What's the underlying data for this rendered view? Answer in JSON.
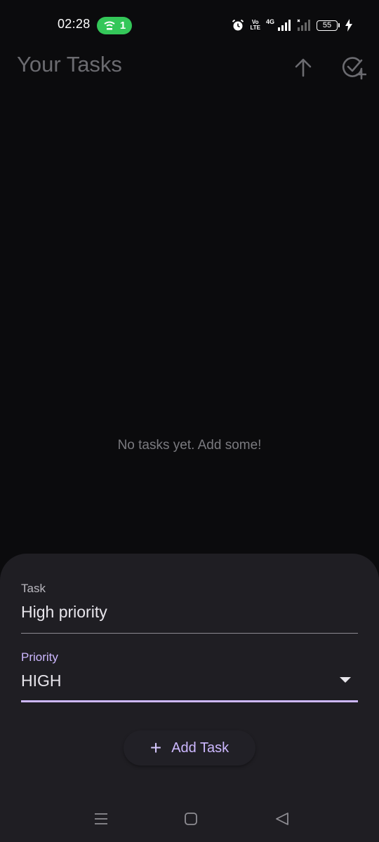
{
  "status_bar": {
    "time": "02:28",
    "hotspot_count": "1",
    "volte_top": "Vo",
    "volte_bottom": "LTE",
    "network_type": "4G",
    "battery_level": "55",
    "colors": {
      "hotspot": "#34c759"
    }
  },
  "app_bar": {
    "title": "Your Tasks",
    "sort_icon": "arrow-up-icon",
    "add_icon": "check-circle-plus-icon"
  },
  "empty_state": {
    "message": "No tasks yet. Add some!"
  },
  "sheet": {
    "task_label": "Task",
    "task_value": "High priority",
    "priority_label": "Priority",
    "priority_value": "HIGH",
    "add_button_label": "Add Task",
    "colors": {
      "accent": "#cdb8ff",
      "sheet_bg": "#1f1e23"
    }
  },
  "nav_bar": {
    "icons": [
      "menu-icon",
      "home-icon",
      "back-icon"
    ]
  }
}
